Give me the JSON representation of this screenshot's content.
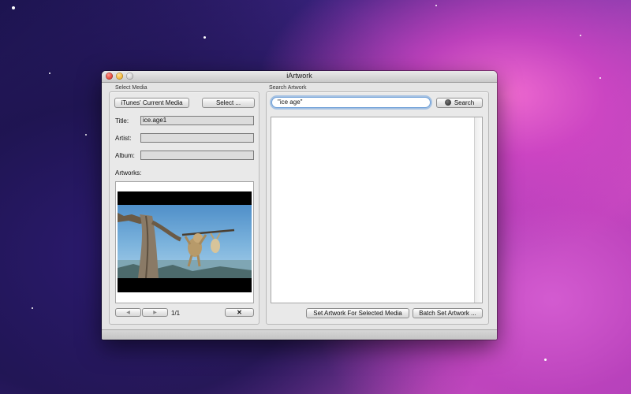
{
  "window": {
    "title": "iArtwork"
  },
  "select_media": {
    "section_label": "Select Media",
    "itunes_button": "iTunes' Current Media",
    "select_button": "Select ...",
    "title_label": "Title:",
    "title_value": "ice.age1",
    "artist_label": "Artist:",
    "artist_value": "",
    "album_label": "Album:",
    "album_value": "",
    "artworks_label": "Artworks:",
    "prev_icon": "◀",
    "next_icon": "▶",
    "page_indicator": "1/1",
    "remove_icon": "✕"
  },
  "search_artwork": {
    "section_label": "Search Artwork",
    "query": "\"ice age\"",
    "search_button": "Search",
    "set_artwork_button": "Set Artwork For Selected Media",
    "batch_button": "Batch Set Artwork ..."
  },
  "colors": {
    "focus_ring": "#6fa0d8",
    "window_bg": "#e4e4e4"
  }
}
